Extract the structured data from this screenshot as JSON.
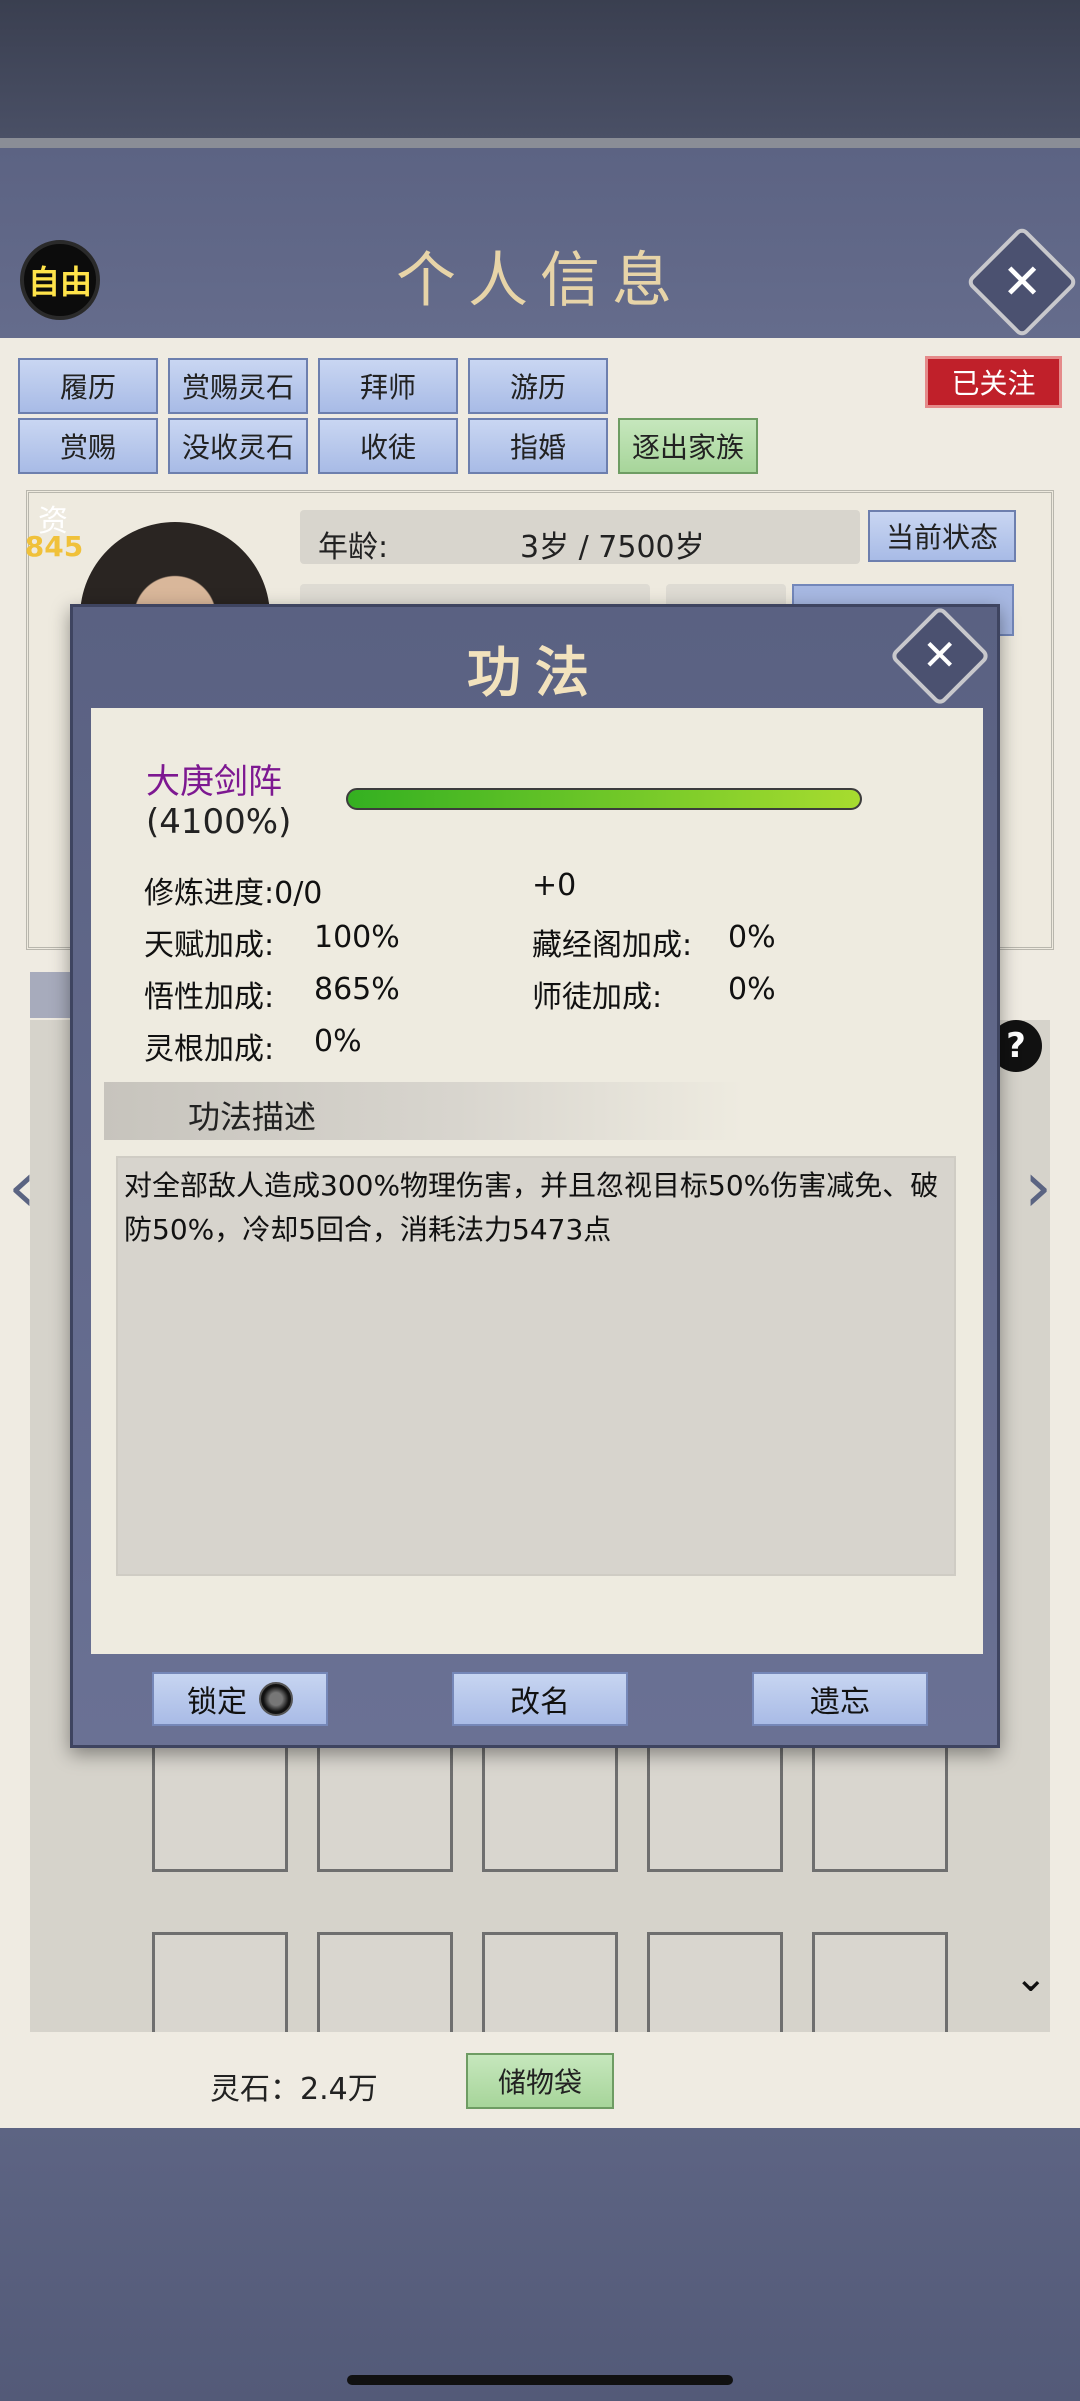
{
  "header": {
    "title": "个人信息",
    "free_badge": "自由",
    "followed_badge": "已关注"
  },
  "actions": {
    "row1": [
      "履历",
      "赏赐灵石",
      "拜师",
      "游历"
    ],
    "row2": [
      "赏赐",
      "没收灵石",
      "收徒",
      "指婚",
      "逐出家族"
    ]
  },
  "profile": {
    "zi_label": "资",
    "zi_value": "845",
    "age_label": "年龄:",
    "age_value": "3岁 / 7500岁",
    "status_button": "当前状态"
  },
  "modal": {
    "title": "功法",
    "skill_name": "大庚剑阵",
    "skill_percent": "(4100%)",
    "progress_fraction": 1.0,
    "stats": {
      "cultivation_progress": "修炼进度:0/0",
      "cultivation_bonus": "+0",
      "talent_label": "天赋加成:",
      "talent_value": "100%",
      "library_label": "藏经阁加成:",
      "library_value": "0%",
      "comprehension_label": "悟性加成:",
      "comprehension_value": "865%",
      "master_label": "师徒加成:",
      "master_value": "0%",
      "root_label": "灵根加成:",
      "root_value": "0%"
    },
    "description_title": "功法描述",
    "description": "对全部敌人造成300%物理伤害，并且忽视目标50%伤害减免、破防50%，冷却5回合，消耗法力5473点",
    "buttons": {
      "lock": "锁定",
      "rename": "改名",
      "forget": "遗忘"
    }
  },
  "footer": {
    "spirit_stones": "灵石：2.4万",
    "bag_button": "储物袋"
  },
  "colors": {
    "header_bg": "#606787",
    "skill_name": "#7d1891",
    "followed_bg": "#c0202a",
    "button_blue": "#b6c6ec",
    "button_green": "#b3dca7"
  }
}
